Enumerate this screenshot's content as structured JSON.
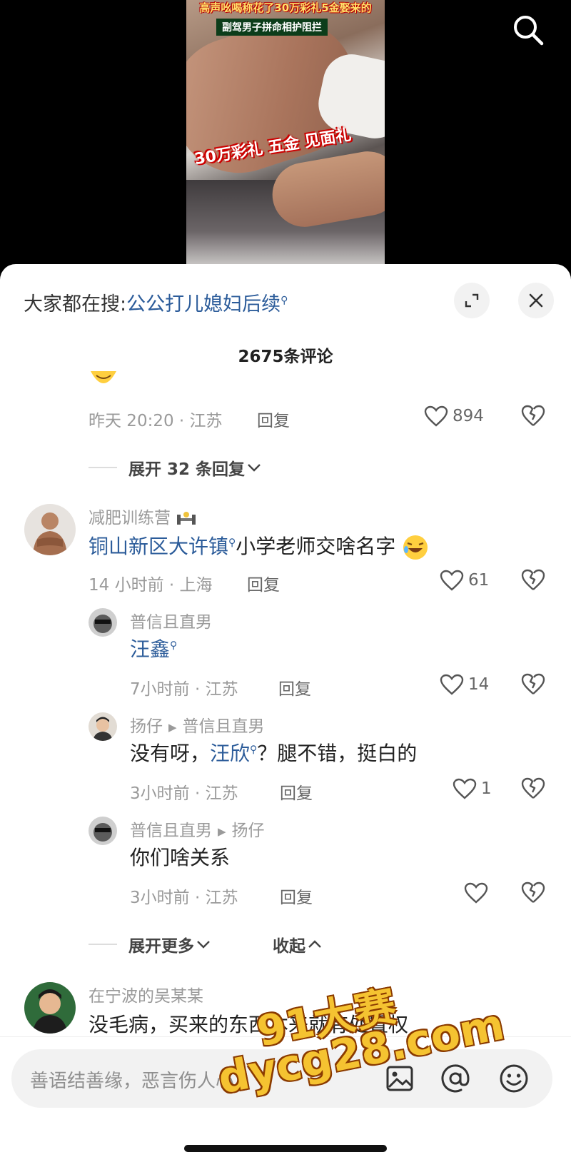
{
  "video": {
    "caption_top": "高声吆喝称花了30万彩礼5金娶来的",
    "caption_mid": "副驾男子拼命相护阻拦",
    "caption_big": "30万彩礼 五金 见面礼"
  },
  "header": {
    "suggest_prefix": "大家都在搜:",
    "suggest_keyword": "公公打儿媳妇后续",
    "comment_count": "2675条评论"
  },
  "comment0": {
    "time_loc": "昨天 20:20 · 江苏",
    "reply_label": "回复",
    "likes": "894",
    "expand_label": "展开 32 条回复"
  },
  "comment1": {
    "user": "减肥训练营",
    "text_keyword": "铜山新区大许镇",
    "text_rest": "小学老师交啥名字",
    "time_loc": "14 小时前 · 上海",
    "reply_label": "回复",
    "likes": "61"
  },
  "replies": [
    {
      "user": "普信且直男",
      "text_keyword": "汪鑫",
      "time_loc": "7小时前 · 江苏",
      "reply_label": "回复",
      "likes": "14"
    },
    {
      "user": "扬仔",
      "to_user": "普信且直男",
      "text_prefix": "没有呀，",
      "text_keyword": "汪欣",
      "text_rest": "？腿不错，挺白的",
      "time_loc": "3小时前 · 江苏",
      "reply_label": "回复",
      "likes": "1"
    },
    {
      "user": "普信且直男",
      "to_user": "扬仔",
      "text": "你们啥关系",
      "time_loc": "3小时前 · 江苏",
      "reply_label": "回复",
      "likes": ""
    }
  ],
  "thread_controls": {
    "expand_more": "展开更多",
    "collapse": "收起"
  },
  "comment2": {
    "user": "在宁波的吴某某",
    "text": "没毛病，买来的东西本来就有处置权"
  },
  "input": {
    "placeholder": "善语结善缘，恶言伤人心"
  },
  "watermark": {
    "line1": "91大赛",
    "line2": "dycg28.com"
  },
  "colors": {
    "keyword_blue": "#2c5c9a",
    "meta_gray": "#9a9a9a",
    "watermark_gold": "#f5c331"
  }
}
